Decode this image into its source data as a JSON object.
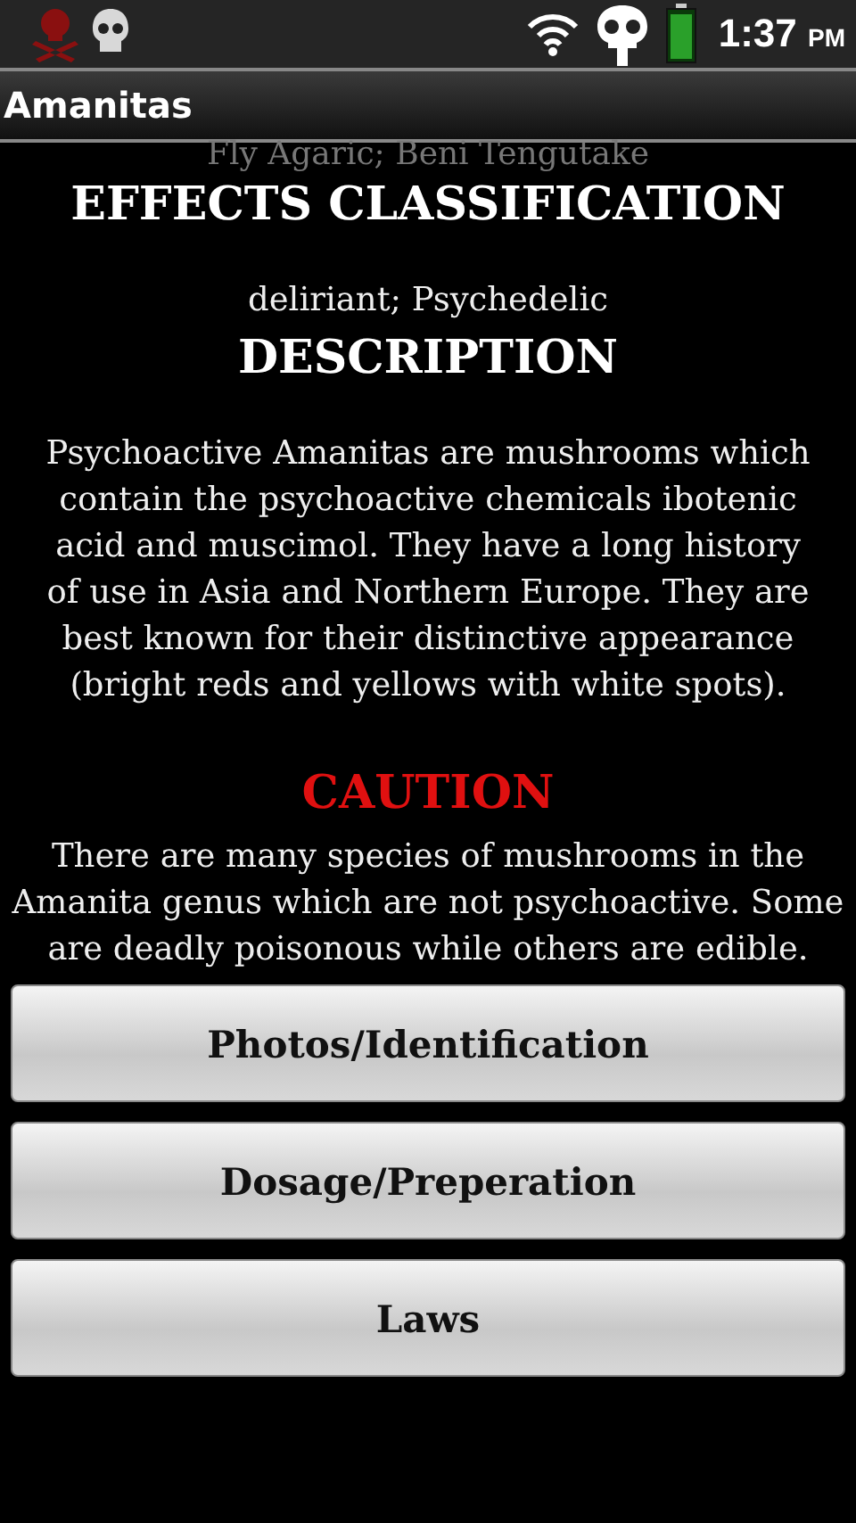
{
  "status_bar": {
    "time": "1:37",
    "meridiem": "PM"
  },
  "title_bar": {
    "title": "Amanitas"
  },
  "content": [
    {
      "kind": "faded",
      "text": "Fly Agaric; Beni Tengutake"
    },
    {
      "kind": "heading",
      "text": "EFFECTS CLASSIFICATION"
    },
    {
      "kind": "text",
      "text": "deliriant; Psychedelic"
    },
    {
      "kind": "heading",
      "text": "DESCRIPTION"
    },
    {
      "kind": "text",
      "text": "Psychoactive Amanitas are mushrooms which contain the psychoactive chemicals ibotenic acid and muscimol. They have a long history of use in Asia and Northern Europe. They are best known for their distinctive appearance (bright reds and yellows with white spots)."
    },
    {
      "kind": "warning",
      "text": "CAUTION"
    },
    {
      "kind": "text",
      "text": "There are many species of mushrooms in the Amanita genus which are not psychoactive. Some are deadly poisonous while others are edible."
    }
  ],
  "buttons": [
    "Photos/Identification",
    "Dosage/Preperation",
    "Laws"
  ]
}
